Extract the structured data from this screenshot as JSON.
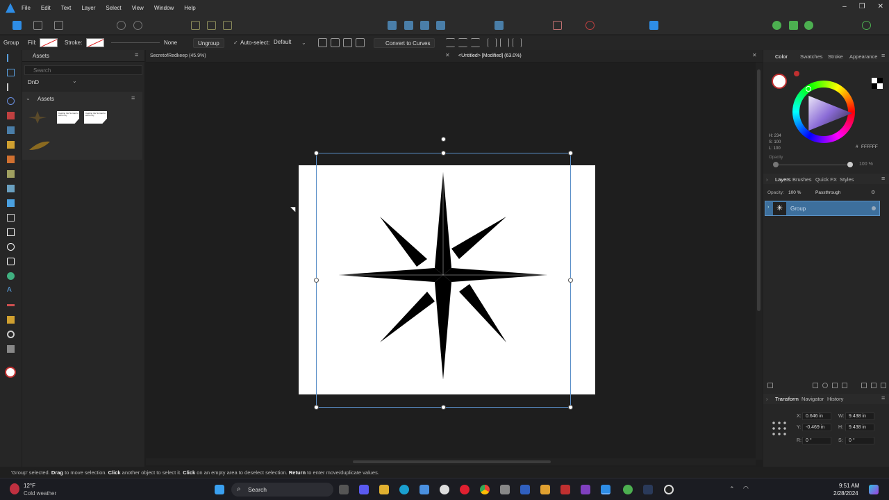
{
  "menubar": {
    "items": [
      "File",
      "Edit",
      "Text",
      "Layer",
      "Select",
      "View",
      "Window",
      "Help"
    ],
    "window_controls": [
      "–",
      "❐",
      "✕"
    ]
  },
  "context": {
    "selection_type": "Group",
    "fill_label": "Fill:",
    "stroke_label": "Stroke:",
    "stroke_style": "None",
    "ungroup": "Ungroup",
    "auto_select_label": "Auto-select:",
    "auto_select_value": "Default",
    "convert_to_curves": "Convert to Curves"
  },
  "assets": {
    "tab": "Assets",
    "search_placeholder": "Search",
    "category": "DnD",
    "group_title": "Assets",
    "thumb_text_1": "Casting the Nomad to within fey",
    "thumb_text_2": "Casting the Nomad to within fey"
  },
  "documents": {
    "tabs": [
      "SecretofRedkeep (45.9%)",
      "<Untitled> [Modified] (63.0%)"
    ]
  },
  "right": {
    "color_tabs": [
      "Color",
      "Swatches",
      "Stroke",
      "Appearance"
    ],
    "hsl": [
      "H: 234",
      "S: 100",
      "L: 100"
    ],
    "hex": "FFFFFF",
    "opacity_label": "Opacity",
    "opacity_value": "100 %",
    "layer_tabs": [
      "Layers",
      "Brushes",
      "Quick FX",
      "Styles"
    ],
    "layer_opacity_label": "Opacity:",
    "layer_opacity_value": "100 %",
    "blend_mode": "Passthrough",
    "layer_name": "Group",
    "transform_tabs": [
      "Transform",
      "Navigator",
      "History"
    ],
    "transform": {
      "x_label": "X:",
      "x": "0.646 in",
      "y_label": "Y:",
      "y": "-0.469 in",
      "w_label": "W:",
      "w": "9.438 in",
      "h_label": "H:",
      "h": "9.438 in",
      "r_label": "R:",
      "r": "0 °",
      "s_label": "S:",
      "s": "0 °"
    }
  },
  "status": {
    "part1": "'Group' selected.",
    "drag": "Drag",
    "part2": "to move selection.",
    "click1": "Click",
    "part3": "another object to select it.",
    "click2": "Click",
    "part4": "on an empty area to deselect selection.",
    "return": "Return",
    "part5": "to enter move/duplicate values."
  },
  "taskbar": {
    "temperature": "12°F",
    "weather": "Cold weather",
    "search": "Search",
    "time": "9:51 AM",
    "date": "2/28/2024"
  },
  "colors": {
    "accent": "#2e8de6",
    "selection": "#5a8fc8",
    "layer_highlight": "#3d6f9c"
  }
}
